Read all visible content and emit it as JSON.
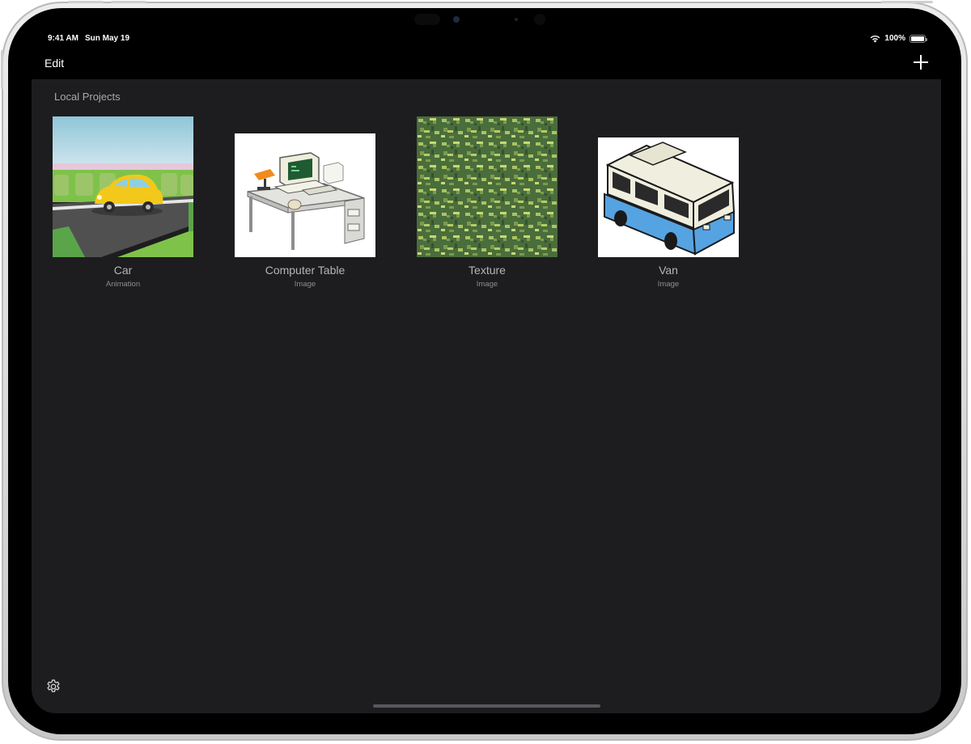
{
  "status_bar": {
    "time": "9:41 AM",
    "date": "Sun May 19",
    "battery": "100%"
  },
  "nav": {
    "edit_label": "Edit"
  },
  "section": {
    "title": "Local Projects"
  },
  "projects": [
    {
      "name": "Car",
      "type": "Animation"
    },
    {
      "name": "Computer Table",
      "type": "Image"
    },
    {
      "name": "Texture",
      "type": "Image"
    },
    {
      "name": "Van",
      "type": "Image"
    }
  ],
  "icons": {
    "add": "plus-icon",
    "settings": "gear-icon",
    "wifi": "wifi-icon",
    "battery": "battery-icon"
  },
  "colors": {
    "background": "#1d1d1f",
    "nav": "#000000",
    "text_primary": "#ffffff",
    "text_secondary": "#a9a9ae"
  }
}
